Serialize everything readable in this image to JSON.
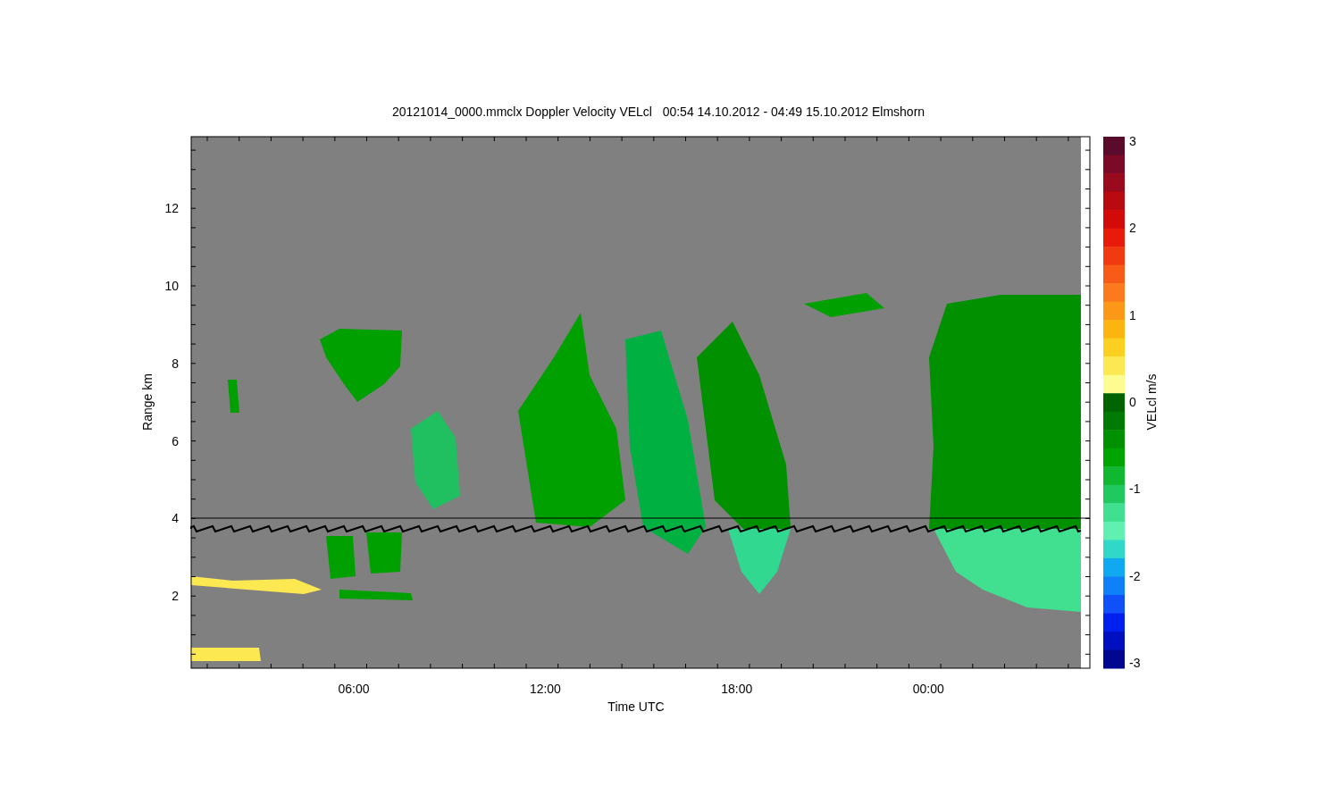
{
  "title": "20121014_0000.mmclx Doppler Velocity VELcl   00:54 14.10.2012 - 04:49 15.10.2012 Elmshorn",
  "y_axis": {
    "label": "Range km",
    "ticks": [
      "12",
      "10",
      "8",
      "6",
      "4",
      "2"
    ]
  },
  "x_axis": {
    "label": "Time UTC",
    "ticks": [
      "06:00",
      "12:00",
      "18:00",
      "00:00"
    ]
  },
  "colorbar": {
    "label": "VELcl m/s",
    "ticks": [
      "3",
      "2",
      "1",
      "0",
      "-1",
      "-2",
      "-3"
    ]
  }
}
